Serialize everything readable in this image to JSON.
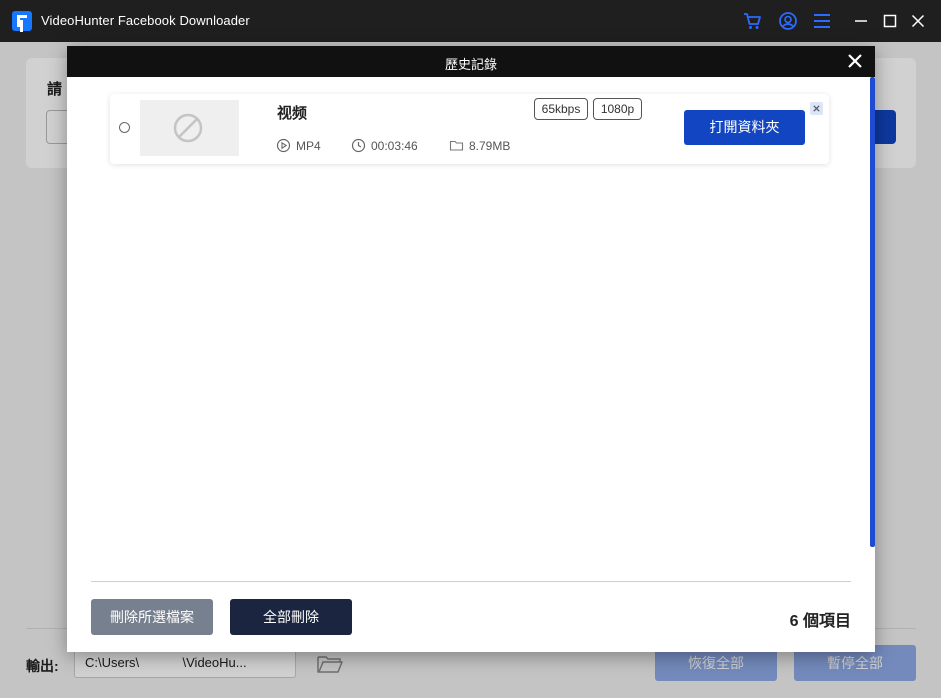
{
  "app": {
    "title": "VideoHunter Facebook Downloader",
    "accent": "#1245c2",
    "icons": [
      "cart-icon",
      "account-icon",
      "menu-icon",
      "minimize-icon",
      "maximize-icon",
      "close-icon"
    ]
  },
  "main": {
    "prompt": "請"
  },
  "footer": {
    "output_label": "輸出:",
    "output_path": "C:\\Users\\            \\VideoHu...",
    "resume_all": "恢復全部",
    "pause_all": "暫停全部"
  },
  "history": {
    "title": "歷史記錄",
    "items": [
      {
        "name": "视频",
        "format": "MP4",
        "duration": "00:03:46",
        "size": "8.79MB",
        "bitrate": "65kbps",
        "resolution": "1080p",
        "open_label": "打開資料夾"
      }
    ],
    "delete_selected": "刪除所選檔案",
    "delete_all": "全部刪除",
    "count_label": "6 個項目"
  }
}
